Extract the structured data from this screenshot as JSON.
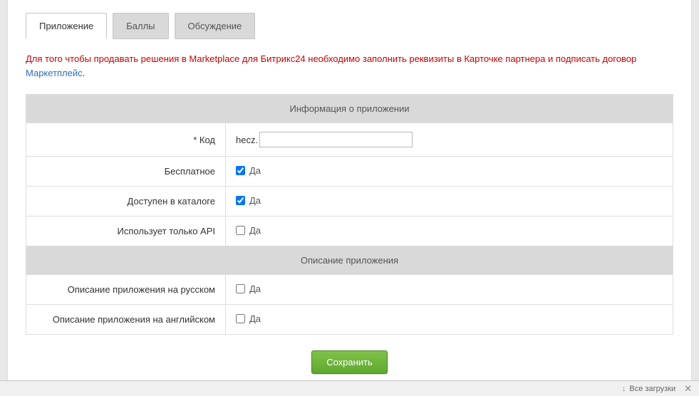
{
  "tabs": {
    "app": "Приложение",
    "points": "Баллы",
    "discussion": "Обсуждение"
  },
  "notice": {
    "text_before": "Для того чтобы продавать решения в Marketplace для Битрикс24 необходимо заполнить реквизиты в Карточке партнера и подписать договор ",
    "link_text": "Маркетплейс",
    "text_after": "."
  },
  "sections": {
    "app_info": "Информация о приложении",
    "app_desc": "Описание приложения"
  },
  "fields": {
    "code": {
      "label": "* Код",
      "prefix": "hecz.",
      "value": ""
    },
    "free": {
      "label": "Бесплатное",
      "option": "Да",
      "checked": true
    },
    "in_catalog": {
      "label": "Доступен в каталоге",
      "option": "Да",
      "checked": true
    },
    "api_only": {
      "label": "Использует только API",
      "option": "Да",
      "checked": false
    },
    "desc_ru": {
      "label": "Описание приложения на русском",
      "option": "Да",
      "checked": false
    },
    "desc_en": {
      "label": "Описание приложения на английском",
      "option": "Да",
      "checked": false
    }
  },
  "buttons": {
    "save": "Сохранить"
  },
  "statusbar": {
    "downloads": "Все загрузки"
  }
}
